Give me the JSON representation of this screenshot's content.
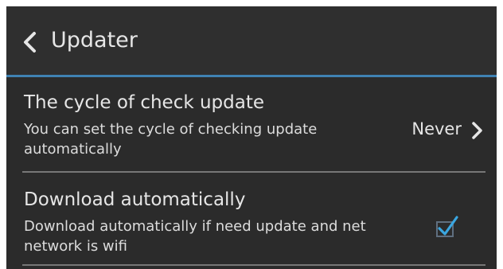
{
  "header": {
    "title": "Updater"
  },
  "settings": {
    "cycle": {
      "title": "The cycle of check update",
      "description": "You can set the cycle of checking update automatically",
      "value": "Never"
    },
    "download": {
      "title": "Download automatically",
      "description": "Download automatically if need update and net network is wifi",
      "checked": true
    }
  },
  "colors": {
    "background": "#2b2b2b",
    "accent": "#3f82b3",
    "checkbox": "#3aa6e0",
    "text": "#e6e6e6"
  },
  "icons": {
    "back": "back-chevron-icon",
    "value_arrow": "chevron-right-icon",
    "checkbox": "checkbox-checked-icon"
  }
}
